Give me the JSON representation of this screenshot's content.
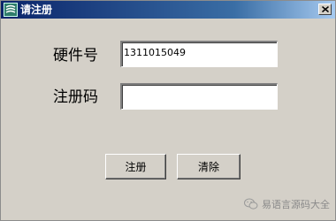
{
  "window": {
    "title": "请注册",
    "close_glyph": "×"
  },
  "form": {
    "hardware_label": "硬件号",
    "hardware_value": "1311015049",
    "register_code_label": "注册码",
    "register_code_value": ""
  },
  "buttons": {
    "register": "注册",
    "clear": "清除"
  },
  "watermark": {
    "text": "易语言源码大全",
    "icon": "wechat-icon"
  },
  "colors": {
    "titlebar_start": "#0a246a",
    "titlebar_end": "#a6caf0",
    "window_bg": "#d4d0c8"
  }
}
